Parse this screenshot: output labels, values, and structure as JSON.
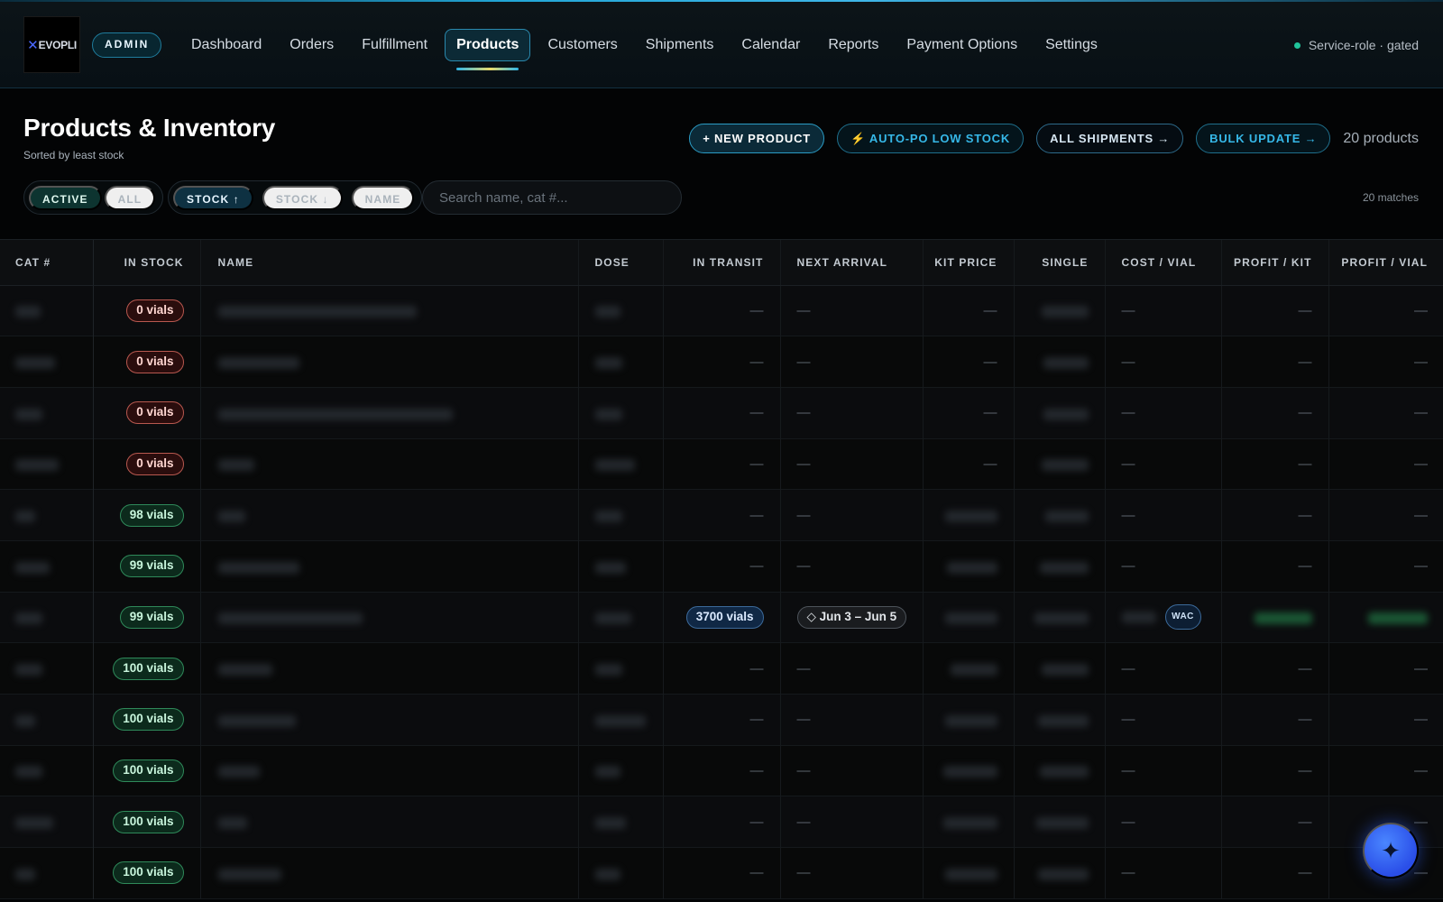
{
  "app": {
    "logo_text": "EVOPLI",
    "role_badge": "ADMIN",
    "status_text": "Service-role · gated",
    "accent_color": "#2fb4e6"
  },
  "nav": {
    "items": [
      {
        "label": "Dashboard",
        "active": false
      },
      {
        "label": "Orders",
        "active": false
      },
      {
        "label": "Fulfillment",
        "active": false
      },
      {
        "label": "Products",
        "active": true
      },
      {
        "label": "Customers",
        "active": false
      },
      {
        "label": "Shipments",
        "active": false
      },
      {
        "label": "Calendar",
        "active": false
      },
      {
        "label": "Reports",
        "active": false
      },
      {
        "label": "Payment Options",
        "active": false
      },
      {
        "label": "Settings",
        "active": false
      }
    ]
  },
  "page": {
    "title": "Products & Inventory",
    "subtitle": "Sorted by least stock",
    "product_count": "20 products",
    "matches": "20 matches"
  },
  "actions": {
    "new_product": "+ NEW PRODUCT",
    "auto_po": "⚡ AUTO-PO LOW STOCK",
    "all_shipments": "ALL SHIPMENTS →",
    "bulk_update": "BULK UPDATE →"
  },
  "filters": {
    "status": {
      "active": "ACTIVE",
      "all": "ALL",
      "selected": "ACTIVE"
    },
    "sort": {
      "stock_up": "STOCK ↑",
      "stock_down": "STOCK ↓",
      "name": "NAME",
      "selected": "STOCK ↑"
    },
    "search": {
      "placeholder": "Search name, cat #...",
      "value": ""
    }
  },
  "table": {
    "columns": [
      "CAT #",
      "IN STOCK",
      "NAME",
      "DOSE",
      "IN TRANSIT",
      "NEXT ARRIVAL",
      "KIT PRICE",
      "SINGLE",
      "COST / VIAL",
      "PROFIT / KIT",
      "PROFIT / VIAL"
    ],
    "rows": [
      {
        "stock": "0 vials",
        "stock_level": "out",
        "in_transit": "—",
        "next_arrival": "—",
        "kit_price": "—",
        "cost_vial": "—",
        "profit_kit": "—",
        "profit_vial": "—"
      },
      {
        "stock": "0 vials",
        "stock_level": "out",
        "in_transit": "—",
        "next_arrival": "—",
        "kit_price": "—",
        "cost_vial": "—",
        "profit_kit": "—",
        "profit_vial": "—"
      },
      {
        "stock": "0 vials",
        "stock_level": "out",
        "in_transit": "—",
        "next_arrival": "—",
        "kit_price": "—",
        "cost_vial": "—",
        "profit_kit": "—",
        "profit_vial": "—"
      },
      {
        "stock": "0 vials",
        "stock_level": "out",
        "in_transit": "—",
        "next_arrival": "—",
        "kit_price": "—",
        "cost_vial": "—",
        "profit_kit": "—",
        "profit_vial": "—"
      },
      {
        "stock": "98 vials",
        "stock_level": "ok",
        "in_transit": "—",
        "next_arrival": "—",
        "kit_price": "",
        "cost_vial": "—",
        "profit_kit": "—",
        "profit_vial": "—"
      },
      {
        "stock": "99 vials",
        "stock_level": "ok",
        "in_transit": "—",
        "next_arrival": "—",
        "kit_price": "",
        "cost_vial": "—",
        "profit_kit": "—",
        "profit_vial": "—"
      },
      {
        "stock": "99 vials",
        "stock_level": "ok",
        "in_transit": "3700 vials",
        "next_arrival": "◇ Jun 3 – Jun 5",
        "kit_price": "",
        "cost_vial": "",
        "cost_badge": "WAC",
        "profit_kit": "",
        "profit_vial": ""
      },
      {
        "stock": "100 vials",
        "stock_level": "ok",
        "in_transit": "—",
        "next_arrival": "—",
        "kit_price": "",
        "cost_vial": "—",
        "profit_kit": "—",
        "profit_vial": "—"
      },
      {
        "stock": "100 vials",
        "stock_level": "ok",
        "in_transit": "—",
        "next_arrival": "—",
        "kit_price": "",
        "cost_vial": "—",
        "profit_kit": "—",
        "profit_vial": "—"
      },
      {
        "stock": "100 vials",
        "stock_level": "ok",
        "in_transit": "—",
        "next_arrival": "—",
        "kit_price": "",
        "cost_vial": "—",
        "profit_kit": "—",
        "profit_vial": "—"
      },
      {
        "stock": "100 vials",
        "stock_level": "ok",
        "in_transit": "—",
        "next_arrival": "—",
        "kit_price": "",
        "cost_vial": "—",
        "profit_kit": "—",
        "profit_vial": "—"
      },
      {
        "stock": "100 vials",
        "stock_level": "ok",
        "in_transit": "—",
        "next_arrival": "—",
        "kit_price": "",
        "cost_vial": "—",
        "profit_kit": "—",
        "profit_vial": "—"
      }
    ]
  },
  "fab": {
    "icon": "sparkle-icon"
  }
}
